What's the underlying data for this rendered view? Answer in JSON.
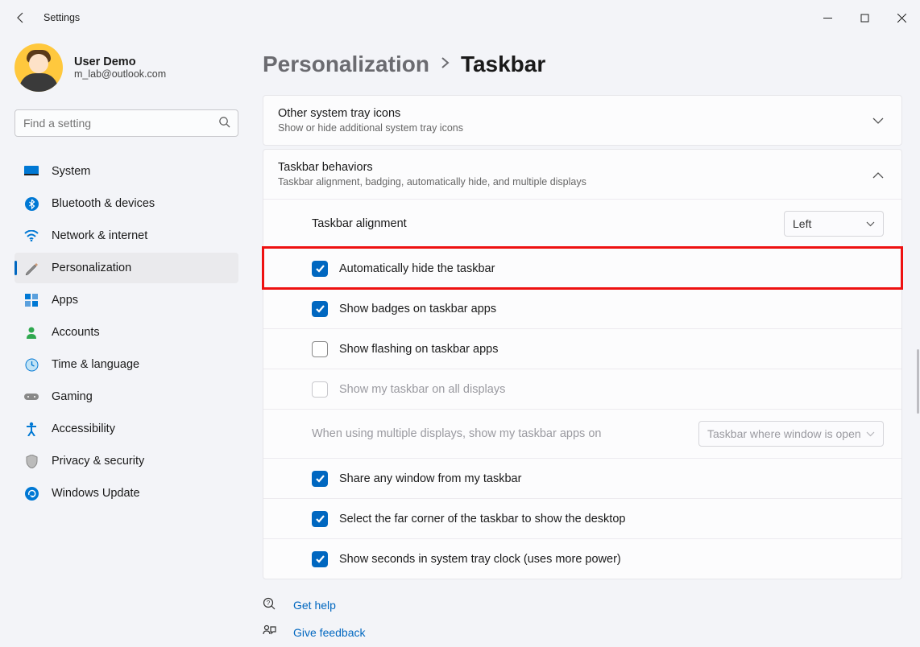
{
  "appTitle": "Settings",
  "user": {
    "name": "User Demo",
    "email": "m_lab@outlook.com"
  },
  "search": {
    "placeholder": "Find a setting"
  },
  "nav": {
    "items": [
      {
        "label": "System"
      },
      {
        "label": "Bluetooth & devices"
      },
      {
        "label": "Network & internet"
      },
      {
        "label": "Personalization"
      },
      {
        "label": "Apps"
      },
      {
        "label": "Accounts"
      },
      {
        "label": "Time & language"
      },
      {
        "label": "Gaming"
      },
      {
        "label": "Accessibility"
      },
      {
        "label": "Privacy & security"
      },
      {
        "label": "Windows Update"
      }
    ]
  },
  "breadcrumb": {
    "parent": "Personalization",
    "current": "Taskbar"
  },
  "cards": {
    "trayIcons": {
      "title": "Other system tray icons",
      "subtitle": "Show or hide additional system tray icons"
    },
    "behaviors": {
      "title": "Taskbar behaviors",
      "subtitle": "Taskbar alignment, badging, automatically hide, and multiple displays"
    }
  },
  "behaviors": {
    "alignment": {
      "label": "Taskbar alignment",
      "value": "Left"
    },
    "autoHide": {
      "checked": true,
      "label": "Automatically hide the taskbar"
    },
    "badges": {
      "checked": true,
      "label": "Show badges on taskbar apps"
    },
    "flashing": {
      "checked": false,
      "label": "Show flashing on taskbar apps"
    },
    "allDisplays": {
      "checked": false,
      "label": "Show my taskbar on all displays",
      "disabled": true
    },
    "multi": {
      "label": "When using multiple displays, show my taskbar apps on",
      "value": "Taskbar where window is open",
      "disabled": true
    },
    "shareWindow": {
      "checked": true,
      "label": "Share any window from my taskbar"
    },
    "farCorner": {
      "checked": true,
      "label": "Select the far corner of the taskbar to show the desktop"
    },
    "showSeconds": {
      "checked": true,
      "label": "Show seconds in system tray clock (uses more power)"
    }
  },
  "help": {
    "getHelp": "Get help",
    "feedback": "Give feedback"
  }
}
